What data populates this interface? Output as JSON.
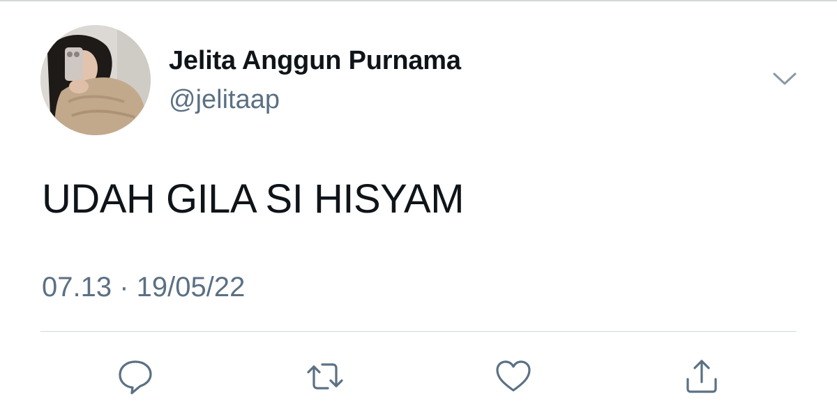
{
  "tweet": {
    "display_name": "Jelita Anggun Purnama",
    "handle": "@jelitaap",
    "text": "UDAH GILA SI HISYAM",
    "timestamp": "07.13 · 19/05/22"
  },
  "actions": {
    "reply_icon": "speech-bubble-icon",
    "retweet_icon": "retweet-arrows-icon",
    "like_icon": "heart-icon",
    "share_icon": "share-upload-icon"
  },
  "colors": {
    "text_primary": "#0f1419",
    "text_secondary": "#5b7083",
    "icon": "#5b7083",
    "divider": "#cfd9de"
  }
}
